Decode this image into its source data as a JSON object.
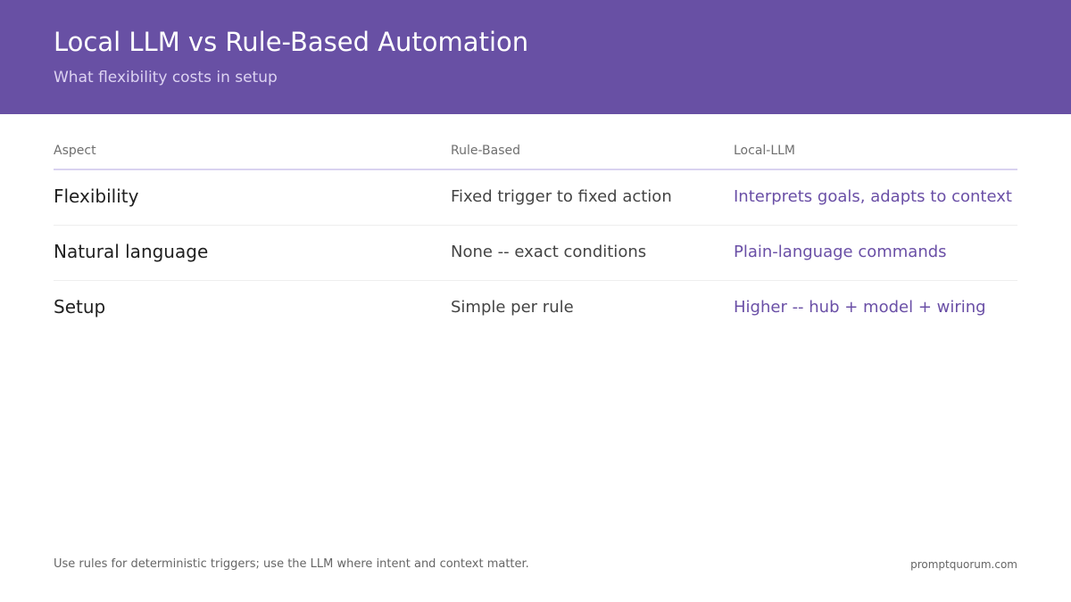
{
  "header": {
    "title": "Local LLM vs Rule-Based Automation",
    "subtitle": "What flexibility costs in setup"
  },
  "table": {
    "columns": [
      "Aspect",
      "Rule-Based",
      "Local-LLM"
    ],
    "rows": [
      [
        "Flexibility",
        "Fixed trigger to fixed action",
        "Interprets goals, adapts to context"
      ],
      [
        "Natural language",
        "None -- exact conditions",
        "Plain-language commands"
      ],
      [
        "Setup",
        "Simple per rule",
        "Higher -- hub + model + wiring"
      ]
    ]
  },
  "footer": {
    "note": "Use rules for deterministic triggers; use the LLM where intent and context matter.",
    "brand": "promptquorum.com"
  },
  "colors": {
    "header_bg": "#6850a4",
    "accent_text": "#6a4fa6",
    "header_rule": "#d9d2f0"
  }
}
